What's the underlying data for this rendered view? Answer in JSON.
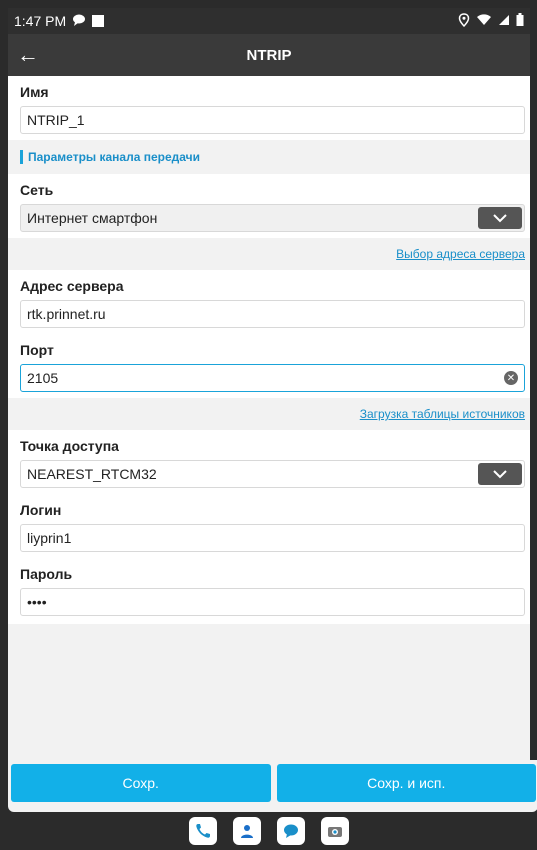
{
  "status": {
    "time": "1:47 PM"
  },
  "appbar": {
    "title": "NTRIP",
    "back": "←"
  },
  "name": {
    "label": "Имя",
    "value": "NTRIP_1"
  },
  "channel_section": {
    "title": "Параметры канала передачи"
  },
  "network": {
    "label": "Сеть",
    "value": "Интернет смартфон"
  },
  "server_select_link": "Выбор адреса сервера",
  "server": {
    "label": "Адрес сервера",
    "value": "rtk.prinnet.ru"
  },
  "port": {
    "label": "Порт",
    "value": "2105"
  },
  "source_table_link": "Загрузка таблицы источников",
  "mountpoint": {
    "label": "Точка доступа",
    "value": "NEAREST_RTCM32"
  },
  "login": {
    "label": "Логин",
    "value": "liyprin1"
  },
  "password": {
    "label": "Пароль",
    "value": "••••"
  },
  "buttons": {
    "save": "Сохр.",
    "save_use": "Сохр. и исп."
  },
  "colors": {
    "accent": "#12b0e8",
    "link": "#1a8fc9",
    "appbar": "#3a3a3a"
  },
  "taskbar_icons": [
    "phone-icon",
    "contacts-icon",
    "messages-icon",
    "camera-icon"
  ]
}
